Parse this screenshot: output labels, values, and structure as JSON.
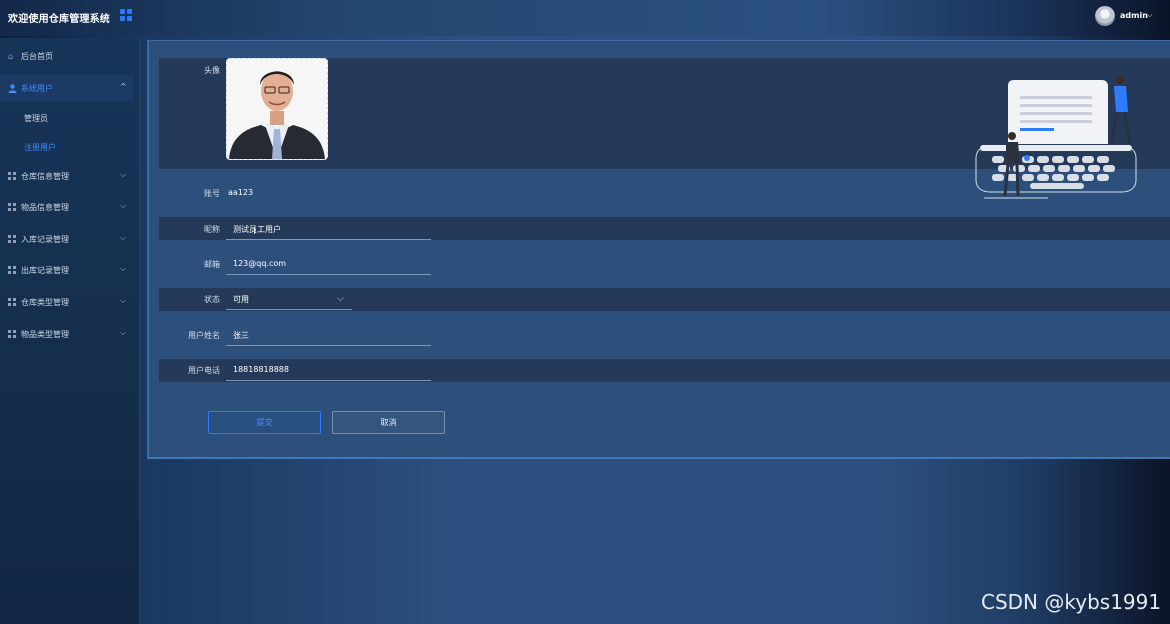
{
  "app": {
    "title": "欢迎使用仓库管理系统",
    "user": "admin"
  },
  "sidebar": {
    "items": [
      {
        "label": "后台首页",
        "icon": "home-icon"
      },
      {
        "label": "系统用户",
        "icon": "user-icon",
        "expanded": true
      },
      {
        "label": "仓库信息管理",
        "icon": "grid-icon"
      },
      {
        "label": "物品信息管理",
        "icon": "grid-icon"
      },
      {
        "label": "入库记录管理",
        "icon": "grid-icon"
      },
      {
        "label": "出库记录管理",
        "icon": "grid-icon"
      },
      {
        "label": "仓库类型管理",
        "icon": "grid-icon"
      },
      {
        "label": "物品类型管理",
        "icon": "grid-icon"
      }
    ],
    "sub_items": [
      {
        "label": "管理员"
      },
      {
        "label": "注册用户",
        "current": true
      }
    ]
  },
  "form": {
    "avatar_label": "头像",
    "account": {
      "label": "账号",
      "value": "aa123"
    },
    "nickname": {
      "label": "昵称",
      "value": "测试员工用户"
    },
    "email": {
      "label": "邮箱",
      "value": "123@qq.com"
    },
    "status": {
      "label": "状态",
      "value": "可用"
    },
    "realname": {
      "label": "用户姓名",
      "value": "张三"
    },
    "phone": {
      "label": "用户电话",
      "value": "18818818888"
    },
    "submit_label": "提交",
    "cancel_label": "取消"
  },
  "colors": {
    "accent": "#2f7bff",
    "panel": "#2c4f7c",
    "band": "#253a59"
  },
  "watermark": "CSDN @kybs1991"
}
